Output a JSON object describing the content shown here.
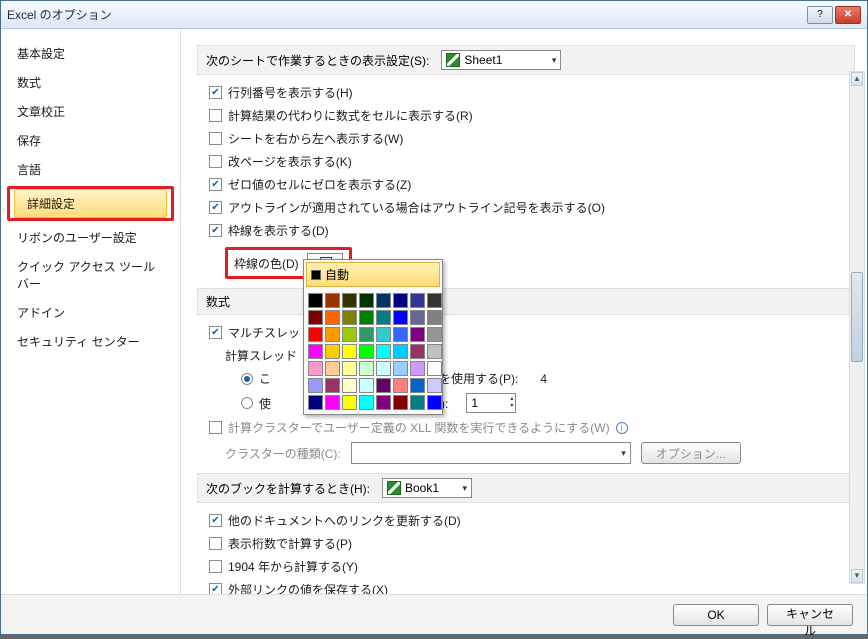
{
  "title": "Excel のオプション",
  "sidebar": {
    "items": [
      {
        "label": "基本設定"
      },
      {
        "label": "数式"
      },
      {
        "label": "文章校正"
      },
      {
        "label": "保存"
      },
      {
        "label": "言語"
      },
      {
        "label": "詳細設定"
      },
      {
        "label": "リボンのユーザー設定"
      },
      {
        "label": "クイック アクセス ツール バー"
      },
      {
        "label": "アドイン"
      },
      {
        "label": "セキュリティ センター"
      }
    ]
  },
  "sections": {
    "display": {
      "header": "次のシートで作業するときの表示設定(S):",
      "sheet": "Sheet1"
    },
    "opts": [
      {
        "label": "行列番号を表示する(H)",
        "checked": true
      },
      {
        "label": "計算結果の代わりに数式をセルに表示する(R)",
        "checked": false
      },
      {
        "label": "シートを右から左へ表示する(W)",
        "checked": false
      },
      {
        "label": "改ページを表示する(K)",
        "checked": false
      },
      {
        "label": "ゼロ値のセルにゼロを表示する(Z)",
        "checked": true
      },
      {
        "label": "アウトラインが適用されている場合はアウトライン記号を表示する(O)",
        "checked": true
      },
      {
        "label": "枠線を表示する(D)",
        "checked": true
      }
    ],
    "gridColor": {
      "label": "枠線の色(D)",
      "auto": "自動"
    },
    "formula": {
      "header": "数式",
      "multi": {
        "label": "マルチスレッド",
        "checked": true
      },
      "threads": "計算スレッド",
      "useAll": {
        "label1": "こ",
        "label2": "ッセサを使用する(P):",
        "value": "4"
      },
      "useN": {
        "label1": "使",
        "label2": "する(M):",
        "value": "1"
      },
      "cluster": {
        "label": "計算クラスターでユーザー定義の XLL 関数を実行できるようにする(W)",
        "checked": false
      },
      "clusterType": "クラスターの種類(C):",
      "optionsBtn": "オプション..."
    },
    "book": {
      "header": "次のブックを計算するとき(H):",
      "bookName": "Book1",
      "opts": [
        {
          "label": "他のドキュメントへのリンクを更新する(D)",
          "checked": true
        },
        {
          "label": "表示桁数で計算する(P)",
          "checked": false
        },
        {
          "label": "1904 年から計算する(Y)",
          "checked": false
        },
        {
          "label": "外部リンクの値を保存する(X)",
          "checked": true
        }
      ]
    }
  },
  "colorPalette": [
    [
      "#000000",
      "#993300",
      "#333300",
      "#003300",
      "#003366",
      "#000080",
      "#333399",
      "#333333"
    ],
    [
      "#800000",
      "#ff6600",
      "#808000",
      "#008000",
      "#008080",
      "#0000ff",
      "#666699",
      "#808080"
    ],
    [
      "#ff0000",
      "#ff9900",
      "#99cc00",
      "#339966",
      "#33cccc",
      "#3366ff",
      "#800080",
      "#969696"
    ],
    [
      "#ff00ff",
      "#ffcc00",
      "#ffff00",
      "#00ff00",
      "#00ffff",
      "#00ccff",
      "#993366",
      "#c0c0c0"
    ],
    [
      "#ff99cc",
      "#ffcc99",
      "#ffff99",
      "#ccffcc",
      "#ccffff",
      "#99ccff",
      "#cc99ff",
      "#ffffff"
    ],
    [
      "#9999ff",
      "#993366",
      "#ffffcc",
      "#ccffff",
      "#660066",
      "#ff8080",
      "#0066cc",
      "#ccccff"
    ],
    [
      "#000080",
      "#ff00ff",
      "#ffff00",
      "#00ffff",
      "#800080",
      "#800000",
      "#008080",
      "#0000ff"
    ]
  ],
  "footer": {
    "ok": "OK",
    "cancel": "キャンセル"
  }
}
